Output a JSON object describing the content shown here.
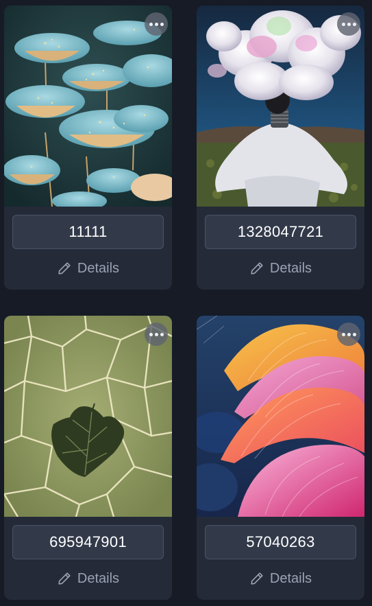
{
  "colors": {
    "background": "#161b26",
    "card": "#242a38",
    "seed_field": "#323a4a",
    "details_text": "#9aa3b3"
  },
  "icons": {
    "more": "more-horizontal-icon",
    "details": "pencil-icon"
  },
  "cards": [
    {
      "seed": "11111",
      "details_label": "Details",
      "image": "teal flower-like mushrooms artwork"
    },
    {
      "seed": "1328047721",
      "details_label": "Details",
      "image": "figure with white flower headpiece in field"
    },
    {
      "seed": "695947901",
      "details_label": "Details",
      "image": "green leaf on cellular texture"
    },
    {
      "seed": "57040263",
      "details_label": "Details",
      "image": "pink and orange seashells"
    }
  ]
}
